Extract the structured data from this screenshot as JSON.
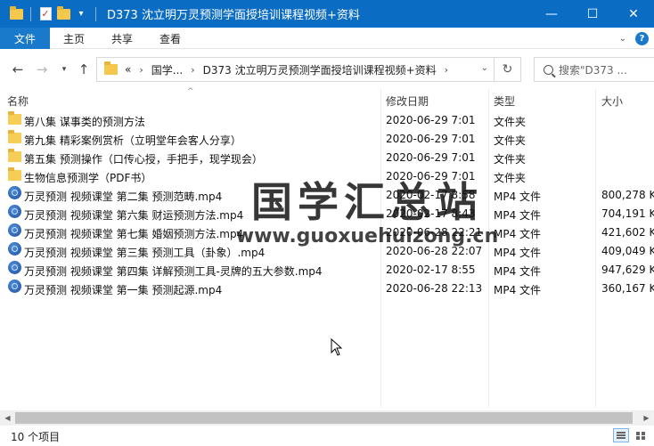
{
  "window": {
    "title": "D373 沈立明万灵预测学面授培训课程视频+资料",
    "controls": [
      "minimize-icon",
      "maximize-icon",
      "close-icon"
    ]
  },
  "ribbon": {
    "tabs": [
      {
        "label": "文件",
        "active": true
      },
      {
        "label": "主页"
      },
      {
        "label": "共享"
      },
      {
        "label": "查看"
      }
    ]
  },
  "address": {
    "overflow": "«",
    "crumbs": [
      "国学...",
      "D373 沈立明万灵预测学面授培训课程视频+资料"
    ],
    "search_placeholder": "搜索\"D373 ..."
  },
  "columns": {
    "name": "名称",
    "date": "修改日期",
    "type": "类型",
    "size": "大小"
  },
  "files": [
    {
      "name": "第八集 谋事类的预测方法",
      "date": "2020-06-29 7:01",
      "type": "文件夹",
      "size": "",
      "icon": "folder-icon"
    },
    {
      "name": "第九集 精彩案例赏析（立明堂年会客人分享）",
      "date": "2020-06-29 7:01",
      "type": "文件夹",
      "size": "",
      "icon": "folder-icon"
    },
    {
      "name": "第五集 预测操作（口传心授，手把手，现学现会）",
      "date": "2020-06-29 7:01",
      "type": "文件夹",
      "size": "",
      "icon": "folder-icon"
    },
    {
      "name": "生物信息预测学（PDF书）",
      "date": "2020-06-29 7:01",
      "type": "文件夹",
      "size": "",
      "icon": "folder-icon"
    },
    {
      "name": "万灵预测 视频课堂 第二集 预测范畴.mp4",
      "date": "2020-02-17 8:58",
      "type": "MP4 文件",
      "size": "800,278 K",
      "icon": "media-file-icon"
    },
    {
      "name": "万灵预测 视频课堂 第六集 财运预测方法.mp4",
      "date": "2020-02-17 8:43",
      "type": "MP4 文件",
      "size": "704,191 K",
      "icon": "media-file-icon"
    },
    {
      "name": "万灵预测 视频课堂 第七集 婚姻预测方法.mp4",
      "date": "2020-06-28 22:21",
      "type": "MP4 文件",
      "size": "421,602 K",
      "icon": "media-file-icon"
    },
    {
      "name": "万灵预测 视频课堂 第三集 预测工具（卦象）.mp4",
      "date": "2020-06-28 22:07",
      "type": "MP4 文件",
      "size": "409,049 K",
      "icon": "media-file-icon"
    },
    {
      "name": "万灵预测 视频课堂 第四集 详解预测工具-灵牌的五大参数.mp4",
      "date": "2020-02-17 8:55",
      "type": "MP4 文件",
      "size": "947,629 K",
      "icon": "media-file-icon"
    },
    {
      "name": "万灵预测 视频课堂 第一集 预测起源.mp4",
      "date": "2020-06-28 22:13",
      "type": "MP4 文件",
      "size": "360,167 K",
      "icon": "media-file-icon"
    }
  ],
  "watermark": {
    "text": "国学汇总站",
    "url": "www.guoxuehuizong.cn"
  },
  "status": {
    "item_count": "10 个项目"
  }
}
